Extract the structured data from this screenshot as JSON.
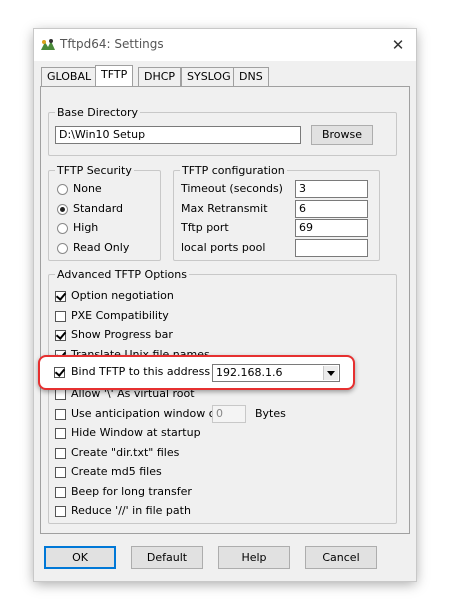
{
  "window": {
    "title": "Tftpd64: Settings",
    "close_glyph": "✕"
  },
  "tabs": [
    {
      "label": "GLOBAL",
      "active": false
    },
    {
      "label": "TFTP",
      "active": true
    },
    {
      "label": "DHCP",
      "active": false
    },
    {
      "label": "SYSLOG",
      "active": false
    },
    {
      "label": "DNS",
      "active": false
    }
  ],
  "base_directory": {
    "legend": "Base Directory",
    "value": "D:\\Win10 Setup",
    "browse_label": "Browse"
  },
  "tftp_security": {
    "legend": "TFTP Security",
    "options": [
      {
        "label": "None",
        "selected": false
      },
      {
        "label": "Standard",
        "selected": true
      },
      {
        "label": "High",
        "selected": false
      },
      {
        "label": "Read Only",
        "selected": false
      }
    ]
  },
  "tftp_configuration": {
    "legend": "TFTP configuration",
    "fields": [
      {
        "label": "Timeout (seconds)",
        "value": "3"
      },
      {
        "label": "Max Retransmit",
        "value": "6"
      },
      {
        "label": "Tftp port",
        "value": "69"
      },
      {
        "label": "local ports pool",
        "value": ""
      }
    ]
  },
  "advanced": {
    "legend": "Advanced TFTP Options",
    "options": [
      {
        "label": "Option negotiation",
        "checked": true
      },
      {
        "label": "PXE Compatibility",
        "checked": false
      },
      {
        "label": "Show Progress bar",
        "checked": true
      },
      {
        "label": "Translate Unix file names",
        "checked": true
      },
      {
        "label": "Bind TFTP to this address",
        "checked": true
      },
      {
        "label": "Allow '\\' As virtual root",
        "checked": false
      },
      {
        "label": "Use anticipation window of",
        "checked": false
      },
      {
        "label": "Hide Window at startup",
        "checked": false
      },
      {
        "label": "Create \"dir.txt\" files",
        "checked": false
      },
      {
        "label": "Create md5 files",
        "checked": false
      },
      {
        "label": "Beep for long transfer",
        "checked": false
      },
      {
        "label": "Reduce '//' in file path",
        "checked": false
      }
    ],
    "bind_address": "192.168.1.6",
    "anticipation_value": "0",
    "anticipation_unit": "Bytes"
  },
  "buttons": {
    "ok": "OK",
    "default": "Default",
    "help": "Help",
    "cancel": "Cancel"
  },
  "colors": {
    "highlight_border": "#e63030",
    "default_button_border": "#0078d7"
  },
  "icons": {
    "app": "tftpd64-app-icon",
    "close": "close-icon",
    "dropdown": "chevron-down-icon"
  }
}
